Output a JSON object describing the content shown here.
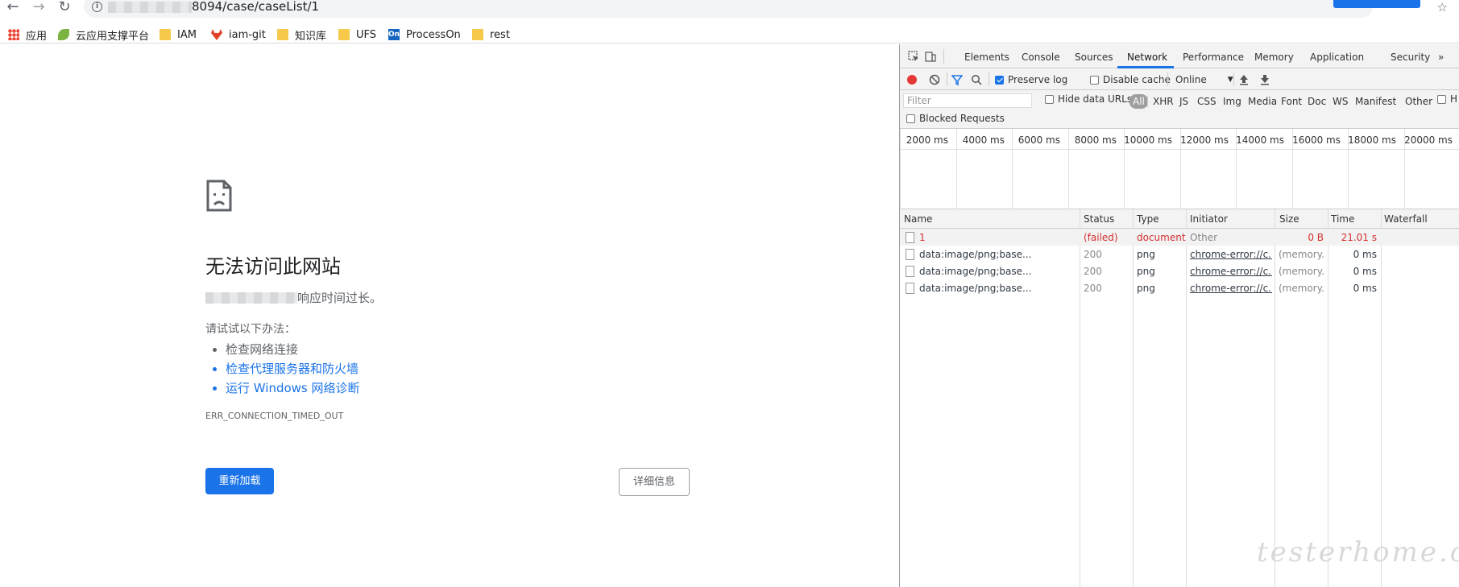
{
  "browser": {
    "url_visible": "8094/case/caseList/1",
    "back_icon": "arrow-left-icon",
    "forward_icon": "arrow-right-icon",
    "reload_icon": "reload-icon",
    "bookmarks": [
      "应用",
      "云应用支撑平台",
      "IAM",
      "iam-git",
      "知识库",
      "UFS",
      "ProcessOn",
      "rest"
    ]
  },
  "error_page": {
    "title": "无法访问此网站",
    "subtitle_suffix": "响应时间过长。",
    "try_label": "请试试以下办法：",
    "suggestions": [
      "检查网络连接",
      "检查代理服务器和防火墙",
      "运行 Windows 网络诊断"
    ],
    "error_code": "ERR_CONNECTION_TIMED_OUT",
    "reload_label": "重新加载",
    "details_label": "详细信息"
  },
  "devtools": {
    "tabs": [
      "Elements",
      "Console",
      "Sources",
      "Network",
      "Performance",
      "Memory",
      "Application",
      "Security"
    ],
    "more_tabs": "»",
    "active_tab": "Network",
    "toolbar": {
      "preserve_log": "Preserve log",
      "disable_cache": "Disable cache",
      "throttle": "Online",
      "throttle_arrow": "▼"
    },
    "filter": {
      "placeholder": "Filter",
      "hide_data_urls": "Hide data URLs",
      "types": [
        "All",
        "XHR",
        "JS",
        "CSS",
        "Img",
        "Media",
        "Font",
        "Doc",
        "WS",
        "Manifest",
        "Other"
      ],
      "extra_cb": "H",
      "blocked_requests": "Blocked Requests"
    },
    "timeline_ticks": [
      "2000 ms",
      "4000 ms",
      "6000 ms",
      "8000 ms",
      "10000 ms",
      "12000 ms",
      "14000 ms",
      "16000 ms",
      "18000 ms",
      "20000 ms"
    ],
    "columns": [
      "Name",
      "Status",
      "Type",
      "Initiator",
      "Size",
      "Time",
      "Waterfall"
    ],
    "rows": [
      {
        "name": "1",
        "status": "(failed)",
        "type": "document",
        "initiator": "Other",
        "size": "0 B",
        "time": "21.01 s"
      },
      {
        "name": "data:image/png;base...",
        "status": "200",
        "type": "png",
        "initiator": "chrome-error://c...",
        "size": "(memory...",
        "time": "0 ms"
      },
      {
        "name": "data:image/png;base...",
        "status": "200",
        "type": "png",
        "initiator": "chrome-error://c...",
        "size": "(memory...",
        "time": "0 ms"
      },
      {
        "name": "data:image/png;base...",
        "status": "200",
        "type": "png",
        "initiator": "chrome-error://c...",
        "size": "(memory...",
        "time": "0 ms"
      }
    ]
  },
  "watermark": "testerhome.com",
  "colors": {
    "accent": "#1a73e8",
    "failed": "#d32f2f",
    "record": "#e53935"
  }
}
